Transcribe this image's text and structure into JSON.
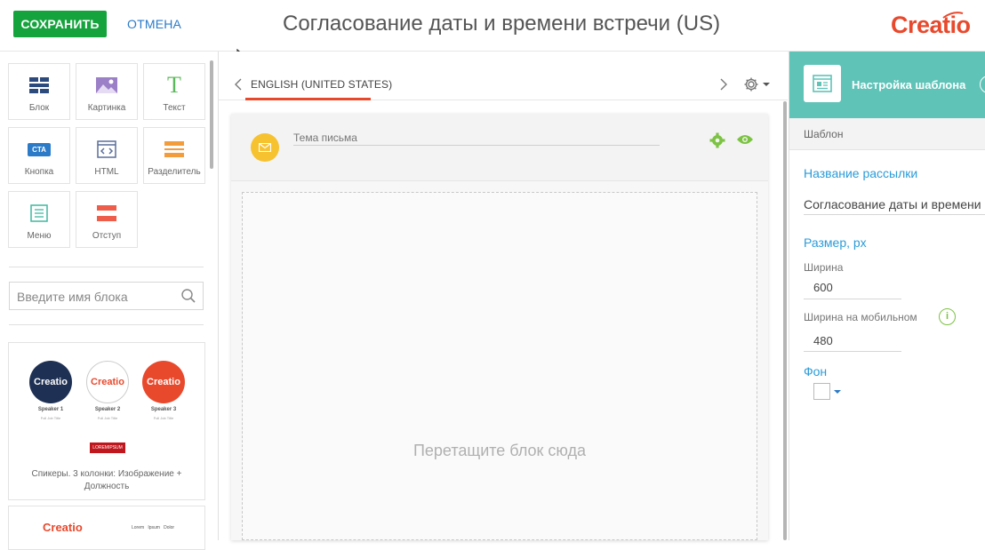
{
  "header": {
    "save_label": "СОХРАНИТЬ",
    "cancel_label": "ОТМЕНА",
    "title": "Согласование даты и времени встречи (US)",
    "logo_text": "Creatio"
  },
  "blocks": [
    {
      "label": "Блок",
      "icon": "block-grid-icon"
    },
    {
      "label": "Картинка",
      "icon": "image-icon"
    },
    {
      "label": "Текст",
      "icon": "text-icon"
    },
    {
      "label": "Кнопка",
      "icon": "cta-button-icon"
    },
    {
      "label": "HTML",
      "icon": "html-code-icon"
    },
    {
      "label": "Разделитель",
      "icon": "divider-icon"
    },
    {
      "label": "Меню",
      "icon": "menu-icon"
    },
    {
      "label": "Отступ",
      "icon": "spacer-icon"
    }
  ],
  "cta_badge": "CTA",
  "search": {
    "placeholder": "Введите имя блока"
  },
  "template_card": {
    "speakers": [
      {
        "logo": "Creatio",
        "name": "Speaker 1",
        "subtitle": "Full Job Title"
      },
      {
        "logo": "Creatio",
        "name": "Speaker 2",
        "subtitle": "Full Job Title"
      },
      {
        "logo": "Creatio",
        "name": "Speaker 3",
        "subtitle": "Full Job Title"
      }
    ],
    "badge": "LOREMIPSUM",
    "caption": "Спикеры. 3 колонки: Изображение + Должность"
  },
  "template_card2": {
    "logo": "Creatio",
    "links": "Lorem   Ipsum   Dolor"
  },
  "editor": {
    "language_tab": "ENGLISH (UNITED STATES)",
    "subject_placeholder": "Тема письма",
    "drop_hint": "Перетащите блок сюда"
  },
  "settings": {
    "title": "Настройка шаблона",
    "subhead": "Шаблон",
    "mailing_name_label": "Название рассылки",
    "mailing_name_value": "Согласование даты и времени",
    "size_label": "Размер, px",
    "width_label": "Ширина",
    "width_value": "600",
    "mobile_width_label": "Ширина на мобильном",
    "mobile_width_value": "480",
    "background_label": "Фон"
  },
  "colors": {
    "save_green": "#15a33d",
    "link_blue": "#2b7bc8",
    "brand_red": "#e8492d",
    "teal_header": "#5fc3b8",
    "section_blue": "#2b9bd8",
    "icon_green": "#7cc243",
    "mail_yellow": "#f7c230"
  }
}
